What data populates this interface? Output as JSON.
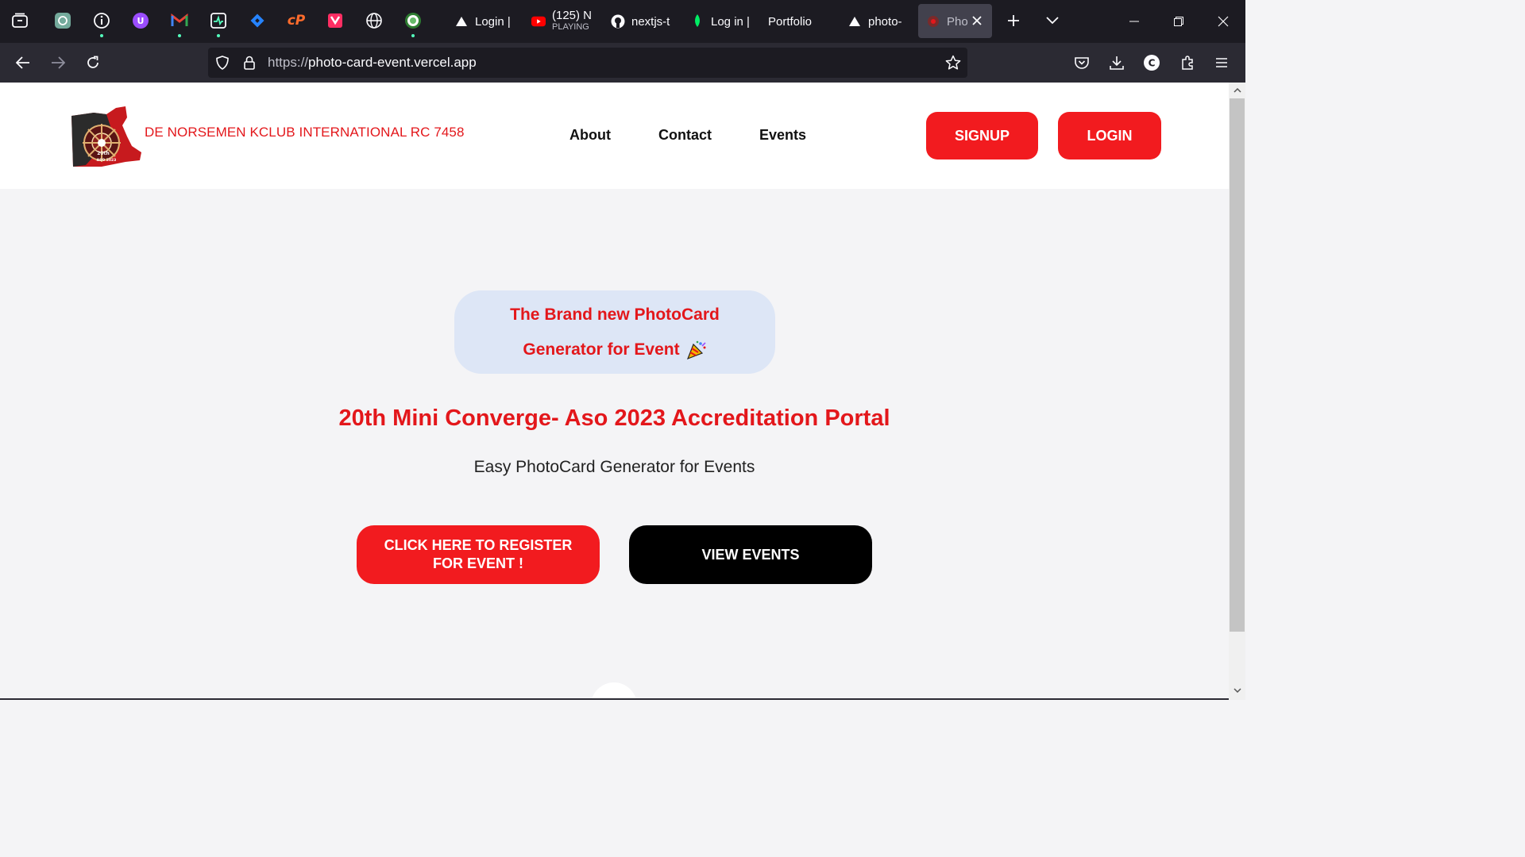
{
  "browser": {
    "tabs": [
      {
        "label": "Login |",
        "icon": "vercel-triangle-icon"
      },
      {
        "label": "(125) N",
        "sublabel": "PLAYING",
        "icon": "youtube-icon"
      },
      {
        "label": "nextjs-t",
        "icon": "github-icon"
      },
      {
        "label": "Log in |",
        "icon": "mongodb-leaf-icon"
      },
      {
        "label": "Portfolio",
        "icon": ""
      },
      {
        "label": "photo-",
        "icon": "vercel-triangle-icon"
      },
      {
        "label": "Pho",
        "icon": "site-favicon",
        "active": true
      }
    ],
    "url_scheme": "https://",
    "url_host": "photo-card-event.vercel.app"
  },
  "site": {
    "brand_name": "DE NORSEMEN KCLUB INTERNATIONAL RC 7458",
    "logo_text": "20th",
    "logo_subtext": "ASO 2023",
    "nav": [
      "About",
      "Contact",
      "Events"
    ],
    "signup_label": "SIGNUP",
    "login_label": "LOGIN"
  },
  "hero": {
    "badge_line1": "The Brand new PhotoCard",
    "badge_line2": "Generator for Event",
    "badge_emoji": "party-popper-icon",
    "title": "20th Mini Converge- Aso 2023 Accreditation Portal",
    "subtitle": "Easy PhotoCard Generator for Events",
    "register_label": "CLICK HERE TO REGISTER FOR EVENT !",
    "view_events_label": "VIEW EVENTS"
  },
  "colors": {
    "accent_red": "#f21b1f",
    "text_red": "#e3171b",
    "badge_bg": "#dde6f6",
    "browser_dark": "#1c1b22"
  }
}
